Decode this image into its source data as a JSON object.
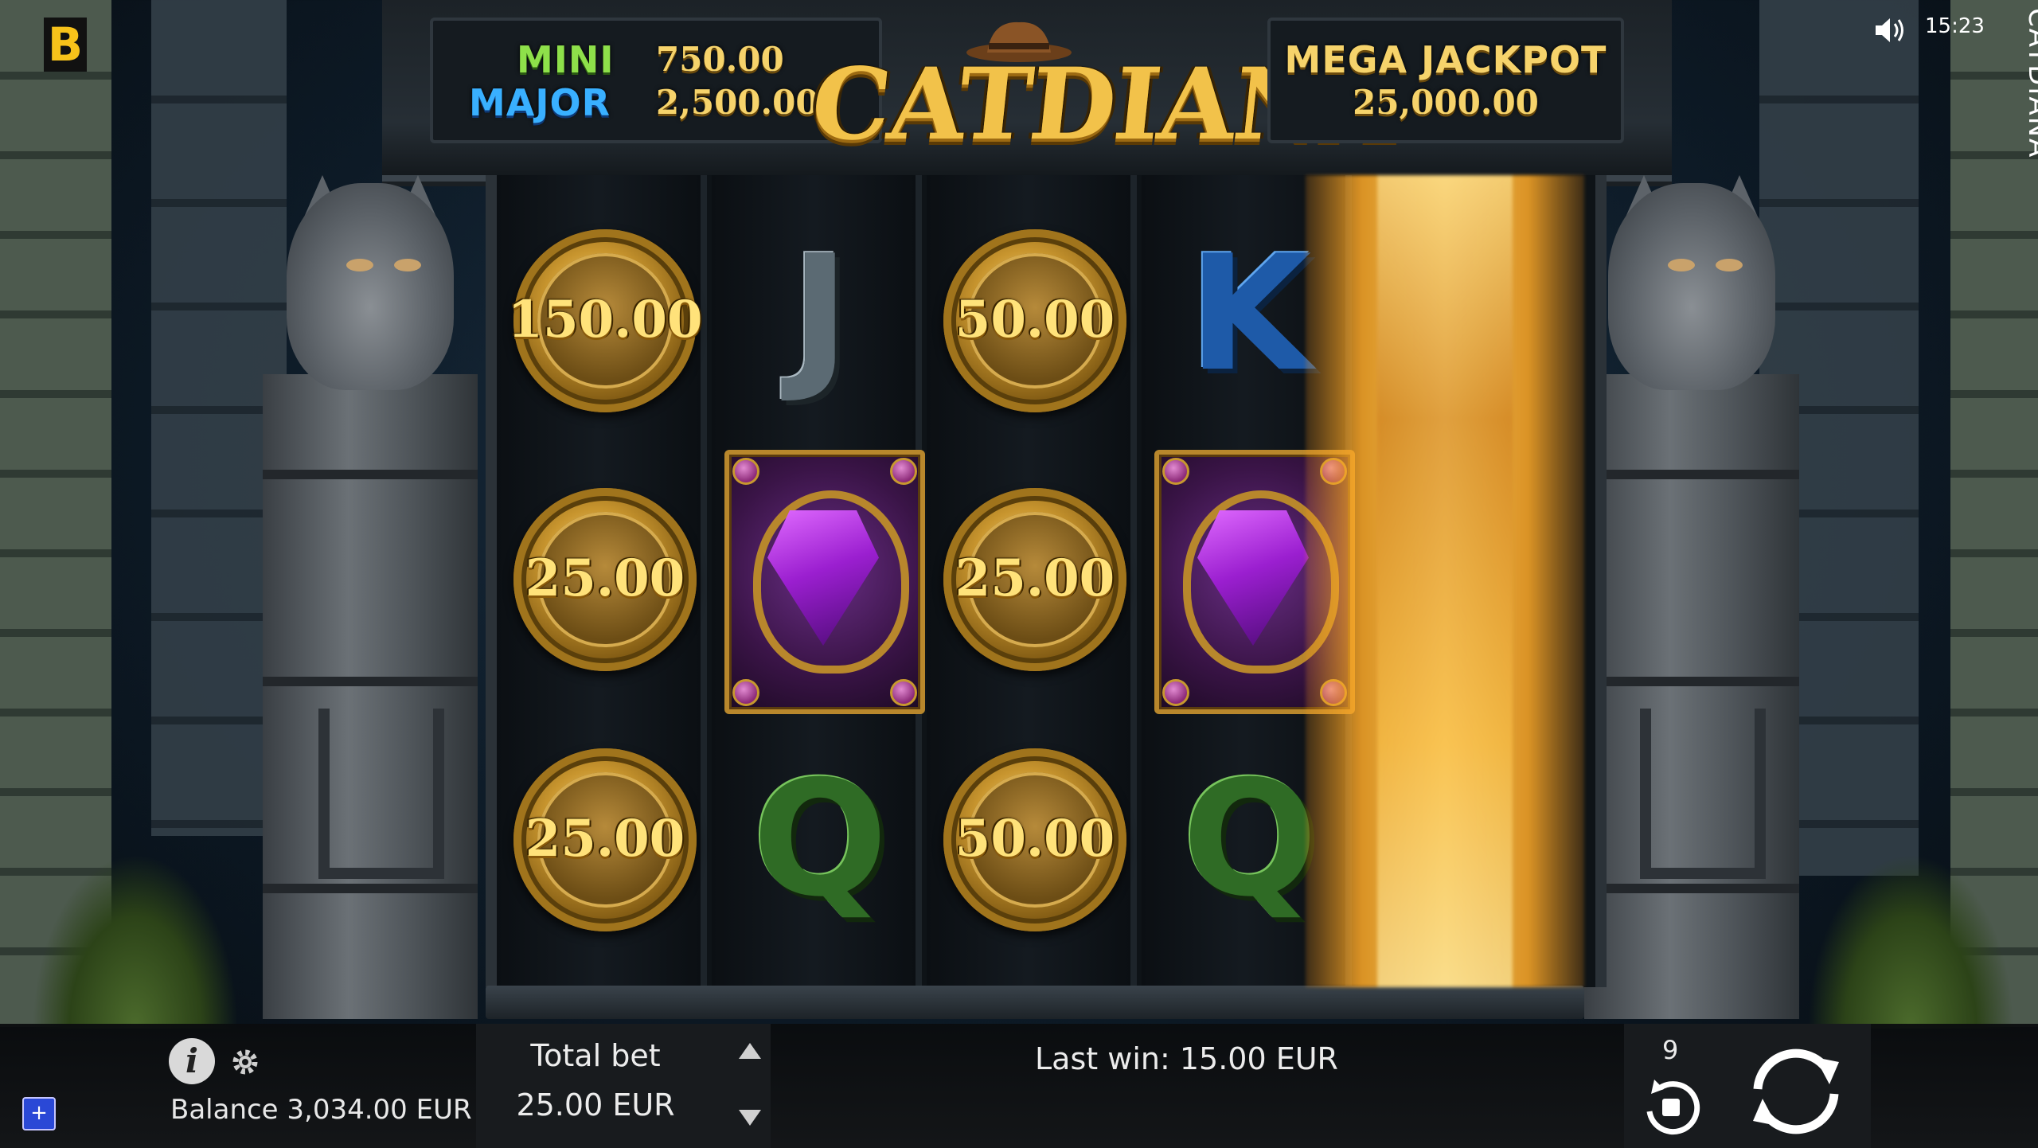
{
  "brand": {
    "letter": "B"
  },
  "top_right": {
    "clock": "15:23",
    "vertical_title": "CATDIANA",
    "sound_icon": "speaker-on-icon"
  },
  "jackpots": {
    "mini_label": "MINI",
    "mini_value": "750.00",
    "major_label": "MAJOR",
    "major_value": "2,500.00",
    "mega_label": "MEGA JACKPOT",
    "mega_value": "25,000.00"
  },
  "logo": {
    "text": "CATDIANA"
  },
  "reels": {
    "col1": [
      {
        "type": "coin",
        "value": "150.00"
      },
      {
        "type": "coin",
        "value": "25.00"
      },
      {
        "type": "coin",
        "value": "25.00"
      }
    ],
    "col2": [
      {
        "type": "letter",
        "value": "J"
      },
      {
        "type": "gem"
      },
      {
        "type": "letter",
        "value": "Q"
      }
    ],
    "col3": [
      {
        "type": "coin",
        "value": "50.00"
      },
      {
        "type": "coin",
        "value": "25.00"
      },
      {
        "type": "coin",
        "value": "50.00"
      }
    ],
    "col4": [
      {
        "type": "letter",
        "value": "K"
      },
      {
        "type": "gem"
      },
      {
        "type": "letter",
        "value": "Q"
      }
    ],
    "col5": [
      {
        "type": "spinning"
      }
    ]
  },
  "bottom": {
    "balance": "Balance 3,034.00 EUR",
    "total_bet_label": "Total bet",
    "total_bet_value": "25.00 EUR",
    "last_win": "Last win: 15.00 EUR",
    "autoplay_count": "9",
    "plus_label": "+"
  },
  "colors": {
    "mini": "#8ee04a",
    "major": "#39b0ff",
    "gold": "#f6d36b",
    "beam": "#ffb42a"
  }
}
